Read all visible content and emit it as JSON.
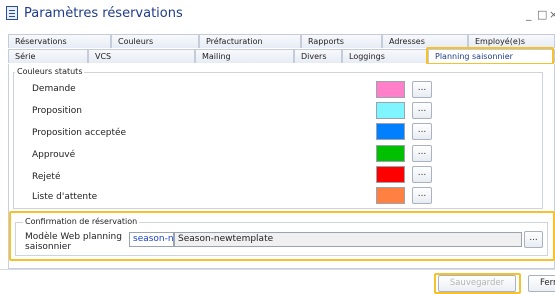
{
  "window": {
    "title": "Paramètres réservations",
    "minimize": "_",
    "maximize": "□",
    "close": "×"
  },
  "tabs_row1": [
    "Réservations",
    "Couleurs",
    "Préfacturation",
    "Rapports",
    "Adresses",
    "Employé(e)s"
  ],
  "tabs_row2": [
    "Série",
    "VCS",
    "Mailing",
    "Divers",
    "Loggings",
    "Planning saisonnier"
  ],
  "active_tab": "Planning saisonnier",
  "status_group": {
    "title": "Couleurs statuts",
    "items": [
      {
        "label": "Demande",
        "color": "#ff7fc8"
      },
      {
        "label": "Proposition",
        "color": "#7ff6ff"
      },
      {
        "label": "Proposition acceptée",
        "color": "#0080ff"
      },
      {
        "label": "Approuvé",
        "color": "#00c000"
      },
      {
        "label": "Rejeté",
        "color": "#ff0000"
      },
      {
        "label": "Liste d'attente",
        "color": "#ff8040"
      }
    ],
    "button_label": "..."
  },
  "confirmation_group": {
    "title": "Confirmation de réservation",
    "web_label": "Modèle Web planning saisonnier",
    "code_value": "season-ne",
    "template_value": "Season-newtemplate",
    "browse_label": "..."
  },
  "footer": {
    "save_label": "Sauvegarder",
    "close_label": "Fermer"
  }
}
